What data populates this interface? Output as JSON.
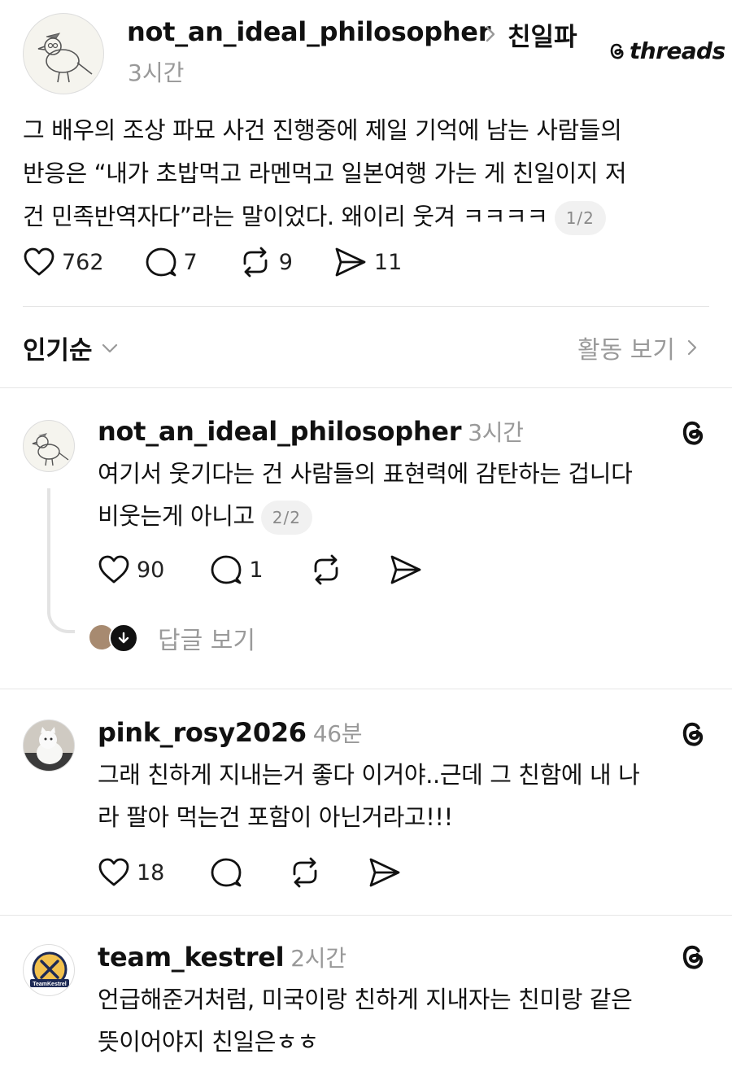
{
  "post": {
    "username": "not_an_ideal_philosopher",
    "topic": "친일파",
    "time": "3시간",
    "brand": "threads",
    "lines": [
      "그 배우의 조상 파묘 사건 진행중에 제일 기억에 남는 사람들의",
      "반응은 “내가 초밥먹고 라멘먹고 일본여행 가는 게 친일이지 저",
      "건 민족반역자다”라는 말이었다. 왜이리 웃겨 ㅋㅋㅋㅋ"
    ],
    "page_badge": "1/2",
    "likes": "762",
    "comments": "7",
    "reposts": "9",
    "shares": "11"
  },
  "sort": {
    "label": "인기순",
    "activity_label": "활동 보기"
  },
  "replies": [
    {
      "username": "not_an_ideal_philosopher",
      "time": "3시간",
      "lines": [
        "여기서 웃기다는 건 사람들의 표현력에 감탄하는 겁니다",
        "비웃는게 아니고"
      ],
      "page_badge": "2/2",
      "likes": "90",
      "comments": "1",
      "view_replies": "답글 보기"
    },
    {
      "username": "pink_rosy2026",
      "time": "46분",
      "lines": [
        "그래 친하게 지내는거 좋다 이거야..근데 그 친함에 내 나",
        "라 팔아 먹는건 포함이 아닌거라고!!!"
      ],
      "likes": "18"
    },
    {
      "username": "team_kestrel",
      "time": "2시간",
      "avatar_text": "TeamKestrel",
      "lines": [
        "언급해준거처럼, 미국이랑 친하게 지내자는 친미랑 같은",
        "뜻이어야지 친일은ㅎㅎ"
      ]
    }
  ]
}
